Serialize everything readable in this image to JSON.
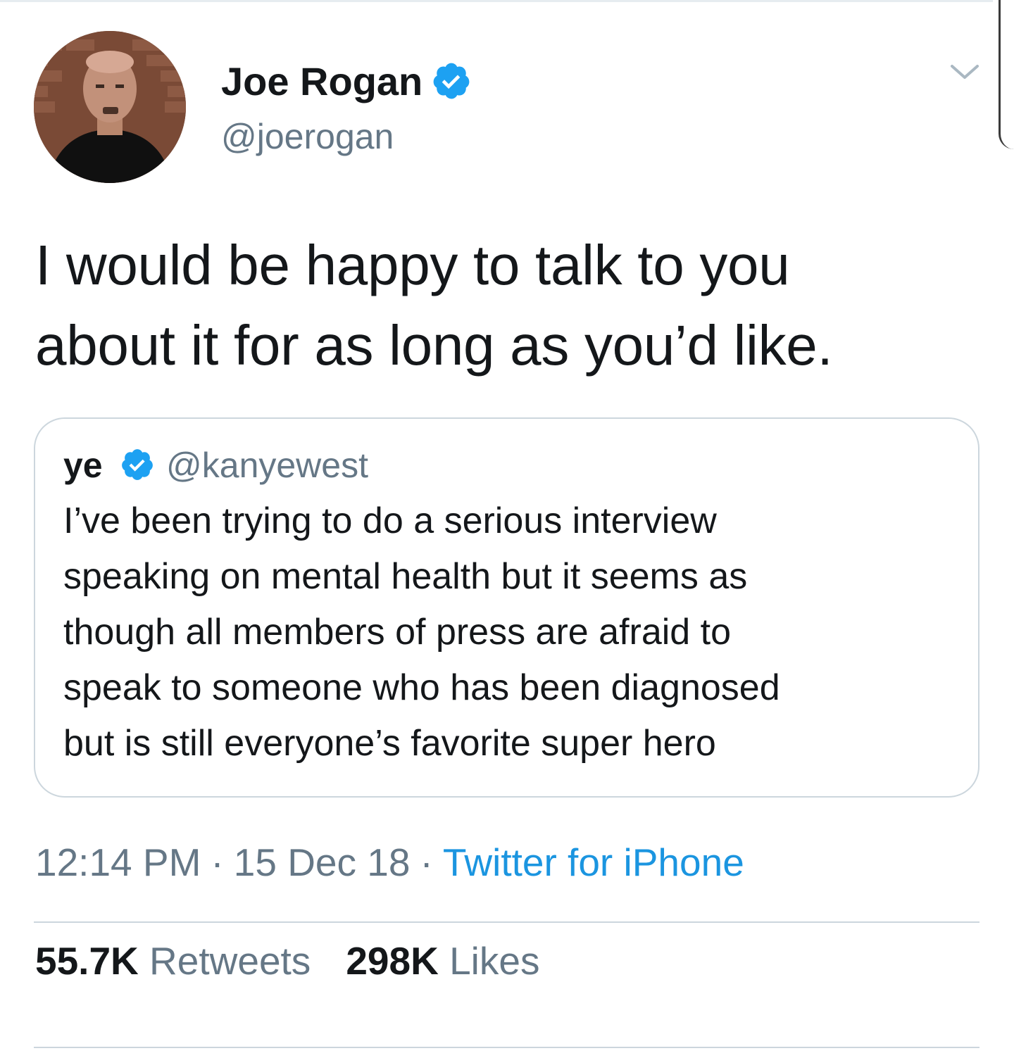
{
  "tweet": {
    "author": {
      "display_name": "Joe Rogan",
      "handle": "@joerogan",
      "verified": true,
      "avatar_icon": "profile-photo"
    },
    "text_lines": [
      "I would be happy to talk to you",
      "about it for as long as you’d like."
    ],
    "quoted_tweet": {
      "display_name": "ye",
      "handle": "@kanyewest",
      "verified": true,
      "text_lines": [
        "I’ve been trying to do a serious interview",
        "speaking on mental health but it seems as",
        "though all members of press are afraid to",
        "speak to someone who has been diagnosed",
        "but is still everyone’s favorite super hero"
      ]
    },
    "meta": {
      "time": "12:14 PM",
      "separator": "·",
      "date": "15 Dec 18",
      "source": "Twitter for iPhone"
    },
    "stats": {
      "retweets_count": "55.7K",
      "retweets_label": "Retweets",
      "likes_count": "298K",
      "likes_label": "Likes"
    }
  },
  "colors": {
    "primary_text": "#14171a",
    "secondary_text": "#657786",
    "link": "#1b95e0",
    "verified_badge": "#1da1f2",
    "border": "#ccd6dd"
  },
  "icons": {
    "verified": "verified-badge-icon",
    "caret": "chevron-down-icon"
  }
}
